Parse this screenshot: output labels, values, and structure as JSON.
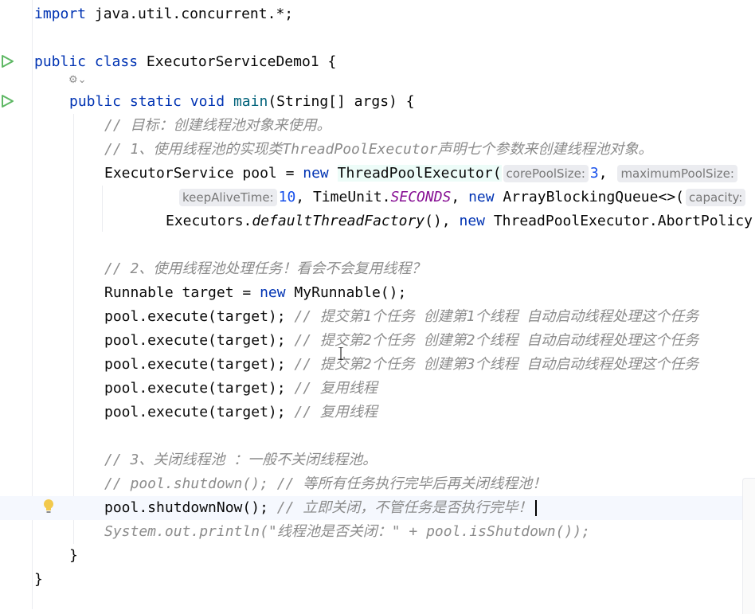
{
  "editor": {
    "lines": {
      "l1": {
        "kw": "import",
        "rest": " java.util.concurrent.*;"
      },
      "l3": {
        "kw1": "public",
        "kw2": "class",
        "name": " ExecutorServiceDemo1 {"
      },
      "l5": {
        "kw1": "public",
        "kw2": "static",
        "kw3": "void",
        "fn": "main",
        "rest": "(String[] args) {"
      },
      "l6": "// 目标：创建线程池对象来使用。",
      "l7": "// 1、使用线程池的实现类ThreadPoolExecutor声明七个参数来创建线程池对象。",
      "l8": {
        "a": "ExecutorService pool = ",
        "kw": "new",
        "cls": "ThreadPoolExecutor",
        "paren": "(",
        "hint1": "corePoolSize:",
        "num1": "3",
        "comma": ",",
        "hint2": "maximumPoolSize:"
      },
      "l9": {
        "hint": "keepAliveTime:",
        "num": "10",
        "a": ", TimeUnit.",
        "const": "SECONDS",
        "b": ", ",
        "kw": "new",
        "c": " ArrayBlockingQueue<>(",
        "hint2": "capacity:"
      },
      "l10": {
        "a": "Executors.",
        "it": "defaultThreadFactory",
        "b": "(), ",
        "kw": "new",
        "c": " ThreadPoolExecutor.AbortPolicy"
      },
      "l12": "// 2、使用线程池处理任务！看会不会复用线程？",
      "l13": {
        "a": "Runnable target = ",
        "kw": "new",
        "b": " MyRunnable();"
      },
      "l14": {
        "code": "pool.execute(target); ",
        "cm": "// 提交第1个任务 创建第1个线程 自动启动线程处理这个任务"
      },
      "l15": {
        "code": "pool.execute(target); ",
        "cm": "// 提交第2个任务 创建第2个线程 自动启动线程处理这个任务"
      },
      "l16": {
        "code": "pool.execute(target); ",
        "cm": "// 提交第2个任务 创建第3个线程 自动启动线程处理这个任务"
      },
      "l17": {
        "code": "pool.execute(target); ",
        "cm": "// 复用线程"
      },
      "l18": {
        "code": "pool.execute(target); ",
        "cm": "// 复用线程"
      },
      "l20": "// 3、关闭线程池 ：一般不关闭线程池。",
      "l21": "// pool.shutdown(); // 等所有任务执行完毕后再关闭线程池！",
      "l22": {
        "code": "pool.shutdownNow(); ",
        "cm": "// 立即关闭，不管任务是否执行完毕！"
      },
      "l23": "System.out.println(\"线程池是否关闭：\" + pool.isShutdown());",
      "l24": "}",
      "l25": "}"
    }
  },
  "colors": {
    "keyword": "#0033b3",
    "comment": "#8c8c8c",
    "number": "#1750eb",
    "run_icon": "#5fb865",
    "bulb": "#f2c94c"
  }
}
